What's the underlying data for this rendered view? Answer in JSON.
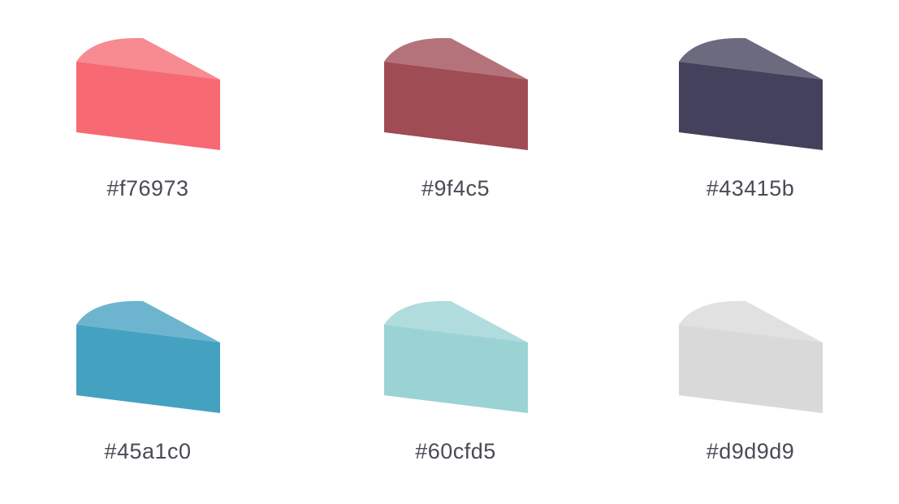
{
  "palette": {
    "swatches": [
      {
        "hex_label": "#f76973",
        "color": "#f76973"
      },
      {
        "hex_label": "#9f4c5",
        "color": "#9f4c55"
      },
      {
        "hex_label": "#43415b",
        "color": "#43415b"
      },
      {
        "hex_label": "#45a1c0",
        "color": "#45a1c0"
      },
      {
        "hex_label": "#60cfd5",
        "color": "#9bd3d5"
      },
      {
        "hex_label": "#d9d9d9",
        "color": "#d9d9d9"
      }
    ]
  }
}
